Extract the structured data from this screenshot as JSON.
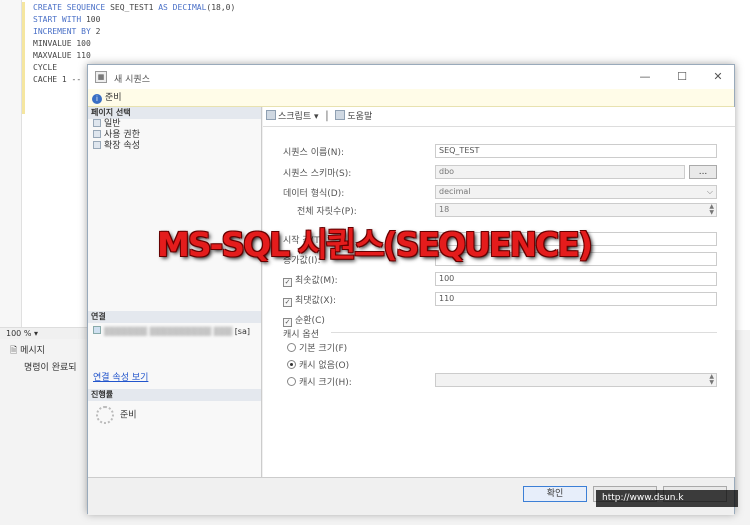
{
  "editor": {
    "line1_kw": "CREATE SEQUENCE",
    "line1_rest": " SEQ_TEST1 ",
    "line1_kw2": "AS DECIMAL",
    "line1_tail": "(18,0)",
    "line2_kw": "START WITH",
    "line2_rest": " 100",
    "line3_kw": "INCREMENT BY",
    "line3_rest": " 2",
    "line4": "MINVALUE 100",
    "line5": "MAXVALUE 110",
    "line6": "CYCLE",
    "line7": "CACHE 1 --"
  },
  "zoom": "100 %",
  "messages_tab": "메시지",
  "messages_text": "명령이 완료되",
  "dialog": {
    "title": "새 시퀀스",
    "status": "준비",
    "left": {
      "page_select_header": "페이지 선택",
      "pages": [
        "일반",
        "사용 권한",
        "확장 속성"
      ],
      "connection_header": "연결",
      "connection_suffix": "[sa]",
      "connection_link": "연결 속성 보기",
      "progress_header": "진행률",
      "progress_status": "준비"
    },
    "toolbar": {
      "script": "스크립트",
      "help": "도움말"
    },
    "form": {
      "name_label": "시퀀스 이름(N):",
      "name_value": "SEQ_TEST",
      "schema_label": "시퀀스 스키마(S):",
      "schema_value": "dbo",
      "schema_btn": "...",
      "datatype_label": "데이터 형식(D):",
      "datatype_value": "decimal",
      "precision_label": "전체 자릿수(P):",
      "precision_value": "18",
      "start_label": "시작 값(T):",
      "increment_label": "증가값(I):",
      "min_label": "최솟값(M):",
      "min_value": "100",
      "max_label": "최댓값(X):",
      "max_value": "110",
      "cycle_label": "순환(C)",
      "cache_group": "캐시 옵션",
      "cache_default": "기본 크기(F)",
      "cache_none": "캐시 없음(O)",
      "cache_size": "캐시 크기(H):"
    },
    "buttons": {
      "ok": "확인"
    }
  },
  "overlay_title": "MS-SQL 시퀀스(SEQUENCE)",
  "watermark": "http://www.dsun.k"
}
